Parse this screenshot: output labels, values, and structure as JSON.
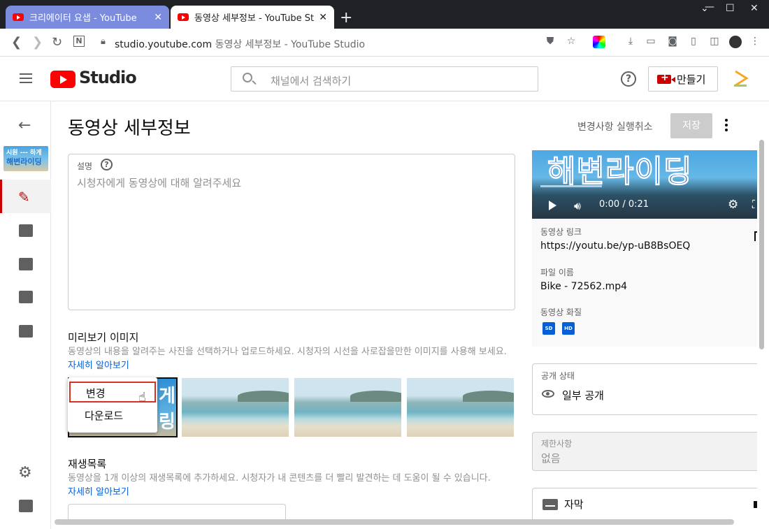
{
  "browser": {
    "tabs": [
      {
        "label": "크리에이터 요샙 - YouTube",
        "active": false
      },
      {
        "label": "동영상 세부정보 - YouTube Stu",
        "active": true
      }
    ],
    "url_domain": "studio.youtube.com",
    "url_title": "동영상 세부정보 - YouTube Studio",
    "icons": [
      "back-icon",
      "forward-icon",
      "reload-icon",
      "lock-icon",
      "shield-icon",
      "star-icon",
      "download-icon",
      "camera-icon",
      "menu-icon"
    ]
  },
  "header": {
    "brand": "Studio",
    "search_placeholder": "채널에서 검색하기",
    "help": "?",
    "create_label": "만들기"
  },
  "rail": {
    "thumb_line1": "시원 --- 하게",
    "thumb_line2": "해변라이딩",
    "items": [
      "edit-icon",
      "analytics-icon",
      "editor-icon",
      "comments-icon",
      "subtitles-icon",
      "settings-icon",
      "feedback-icon"
    ]
  },
  "page": {
    "title": "동영상 세부정보",
    "undo_label": "변경사항 실행취소",
    "save_label": "저장"
  },
  "description": {
    "label": "설명",
    "help": "?",
    "placeholder": "시청자에게 동영상에 대해 알려주세요"
  },
  "thumbnail": {
    "heading": "미리보기 이미지",
    "desc": "동영상의 내용을 알려주는 사진을 선택하거나 업로드하세요. 시청자의 시선을 사로잡을만한 이미지를 사용해 보세요.",
    "learn_more": "자세히 알아보기",
    "thumb1_text": "게\n링",
    "menu": {
      "change": "변경",
      "download": "다운로드"
    }
  },
  "playlist": {
    "heading": "재생목록",
    "desc": "동영상을 1개 이상의 재생목록에 추가하세요. 시청자가 내 콘텐츠를 더 빨리 발견하는 데 도움이 될 수 있습니다.",
    "learn_more": "자세히 알아보기"
  },
  "video": {
    "overlay_title": "해변라이딩",
    "time": "0:00 / 0:21",
    "link_label": "동영상 링크",
    "link": "https://youtu.be/yp-uB8BsOEQ",
    "file_label": "파일 이름",
    "file_name": "Bike - 72562.mp4",
    "quality_label": "동영상 화질",
    "quality_badges": [
      "SD",
      "HD"
    ]
  },
  "visibility": {
    "label": "공개 상태",
    "value": "일부 공개"
  },
  "restrictions": {
    "label": "제한사항",
    "value": "없음"
  },
  "subtitles": {
    "label": "자막"
  },
  "colors": {
    "accent": "#cc0000",
    "link": "#065fd4",
    "yt_red": "#ff0000"
  }
}
